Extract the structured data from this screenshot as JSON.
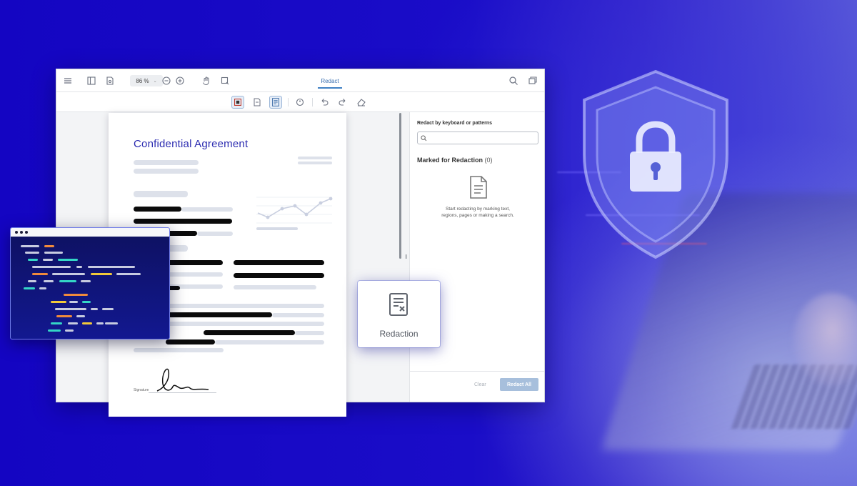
{
  "toolbar": {
    "zoom_value": "86 %",
    "active_tab": "Redact"
  },
  "document": {
    "title": "Confidential Agreement",
    "signature_label": "Signature"
  },
  "redact_panel": {
    "search_title": "Redact by keyboard or patterns",
    "marked_title": "Marked for Redaction",
    "marked_count": "(0)",
    "empty_message": "Start redacting by marking text, regions, pages or making a search.",
    "clear_label": "Clear",
    "redact_all_label": "Redact All"
  },
  "redaction_card": {
    "label": "Redaction"
  },
  "colors": {
    "background": "#1a08c4",
    "accent": "#3f80c4",
    "document_title": "#2b2bb0"
  },
  "icons": [
    "menu-icon",
    "sidebar-icon",
    "file-icon",
    "zoom-out-icon",
    "zoom-in-icon",
    "hand-icon",
    "select-icon",
    "search-icon",
    "comment-icon",
    "redact-region-icon",
    "redact-pages-icon",
    "redact-text-icon",
    "palette-icon",
    "undo-icon",
    "redo-icon",
    "eraser-icon",
    "shield-lock-icon",
    "document-icon"
  ]
}
